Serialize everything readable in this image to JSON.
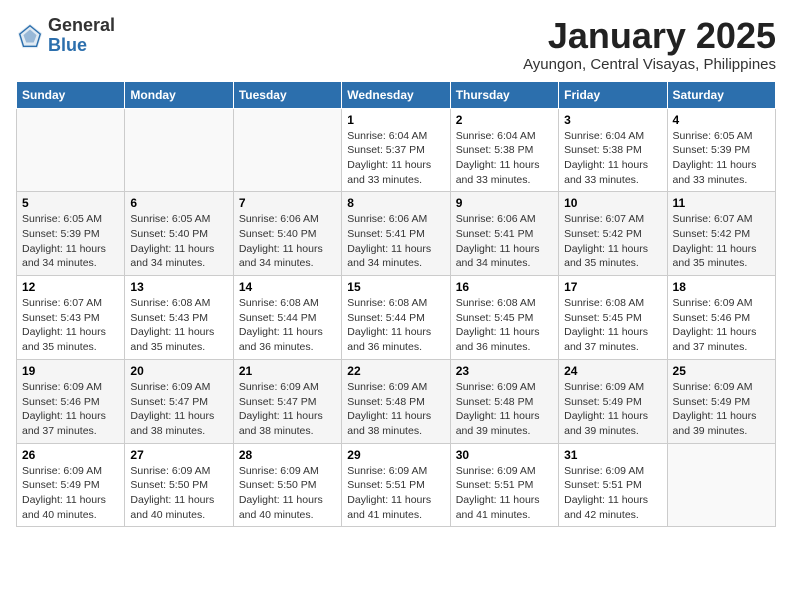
{
  "header": {
    "logo_general": "General",
    "logo_blue": "Blue",
    "month_title": "January 2025",
    "location": "Ayungon, Central Visayas, Philippines"
  },
  "days_of_week": [
    "Sunday",
    "Monday",
    "Tuesday",
    "Wednesday",
    "Thursday",
    "Friday",
    "Saturday"
  ],
  "weeks": [
    [
      {
        "day": "",
        "info": ""
      },
      {
        "day": "",
        "info": ""
      },
      {
        "day": "",
        "info": ""
      },
      {
        "day": "1",
        "info": "Sunrise: 6:04 AM\nSunset: 5:37 PM\nDaylight: 11 hours\nand 33 minutes."
      },
      {
        "day": "2",
        "info": "Sunrise: 6:04 AM\nSunset: 5:38 PM\nDaylight: 11 hours\nand 33 minutes."
      },
      {
        "day": "3",
        "info": "Sunrise: 6:04 AM\nSunset: 5:38 PM\nDaylight: 11 hours\nand 33 minutes."
      },
      {
        "day": "4",
        "info": "Sunrise: 6:05 AM\nSunset: 5:39 PM\nDaylight: 11 hours\nand 33 minutes."
      }
    ],
    [
      {
        "day": "5",
        "info": "Sunrise: 6:05 AM\nSunset: 5:39 PM\nDaylight: 11 hours\nand 34 minutes."
      },
      {
        "day": "6",
        "info": "Sunrise: 6:05 AM\nSunset: 5:40 PM\nDaylight: 11 hours\nand 34 minutes."
      },
      {
        "day": "7",
        "info": "Sunrise: 6:06 AM\nSunset: 5:40 PM\nDaylight: 11 hours\nand 34 minutes."
      },
      {
        "day": "8",
        "info": "Sunrise: 6:06 AM\nSunset: 5:41 PM\nDaylight: 11 hours\nand 34 minutes."
      },
      {
        "day": "9",
        "info": "Sunrise: 6:06 AM\nSunset: 5:41 PM\nDaylight: 11 hours\nand 34 minutes."
      },
      {
        "day": "10",
        "info": "Sunrise: 6:07 AM\nSunset: 5:42 PM\nDaylight: 11 hours\nand 35 minutes."
      },
      {
        "day": "11",
        "info": "Sunrise: 6:07 AM\nSunset: 5:42 PM\nDaylight: 11 hours\nand 35 minutes."
      }
    ],
    [
      {
        "day": "12",
        "info": "Sunrise: 6:07 AM\nSunset: 5:43 PM\nDaylight: 11 hours\nand 35 minutes."
      },
      {
        "day": "13",
        "info": "Sunrise: 6:08 AM\nSunset: 5:43 PM\nDaylight: 11 hours\nand 35 minutes."
      },
      {
        "day": "14",
        "info": "Sunrise: 6:08 AM\nSunset: 5:44 PM\nDaylight: 11 hours\nand 36 minutes."
      },
      {
        "day": "15",
        "info": "Sunrise: 6:08 AM\nSunset: 5:44 PM\nDaylight: 11 hours\nand 36 minutes."
      },
      {
        "day": "16",
        "info": "Sunrise: 6:08 AM\nSunset: 5:45 PM\nDaylight: 11 hours\nand 36 minutes."
      },
      {
        "day": "17",
        "info": "Sunrise: 6:08 AM\nSunset: 5:45 PM\nDaylight: 11 hours\nand 37 minutes."
      },
      {
        "day": "18",
        "info": "Sunrise: 6:09 AM\nSunset: 5:46 PM\nDaylight: 11 hours\nand 37 minutes."
      }
    ],
    [
      {
        "day": "19",
        "info": "Sunrise: 6:09 AM\nSunset: 5:46 PM\nDaylight: 11 hours\nand 37 minutes."
      },
      {
        "day": "20",
        "info": "Sunrise: 6:09 AM\nSunset: 5:47 PM\nDaylight: 11 hours\nand 38 minutes."
      },
      {
        "day": "21",
        "info": "Sunrise: 6:09 AM\nSunset: 5:47 PM\nDaylight: 11 hours\nand 38 minutes."
      },
      {
        "day": "22",
        "info": "Sunrise: 6:09 AM\nSunset: 5:48 PM\nDaylight: 11 hours\nand 38 minutes."
      },
      {
        "day": "23",
        "info": "Sunrise: 6:09 AM\nSunset: 5:48 PM\nDaylight: 11 hours\nand 39 minutes."
      },
      {
        "day": "24",
        "info": "Sunrise: 6:09 AM\nSunset: 5:49 PM\nDaylight: 11 hours\nand 39 minutes."
      },
      {
        "day": "25",
        "info": "Sunrise: 6:09 AM\nSunset: 5:49 PM\nDaylight: 11 hours\nand 39 minutes."
      }
    ],
    [
      {
        "day": "26",
        "info": "Sunrise: 6:09 AM\nSunset: 5:49 PM\nDaylight: 11 hours\nand 40 minutes."
      },
      {
        "day": "27",
        "info": "Sunrise: 6:09 AM\nSunset: 5:50 PM\nDaylight: 11 hours\nand 40 minutes."
      },
      {
        "day": "28",
        "info": "Sunrise: 6:09 AM\nSunset: 5:50 PM\nDaylight: 11 hours\nand 40 minutes."
      },
      {
        "day": "29",
        "info": "Sunrise: 6:09 AM\nSunset: 5:51 PM\nDaylight: 11 hours\nand 41 minutes."
      },
      {
        "day": "30",
        "info": "Sunrise: 6:09 AM\nSunset: 5:51 PM\nDaylight: 11 hours\nand 41 minutes."
      },
      {
        "day": "31",
        "info": "Sunrise: 6:09 AM\nSunset: 5:51 PM\nDaylight: 11 hours\nand 42 minutes."
      },
      {
        "day": "",
        "info": ""
      }
    ]
  ]
}
